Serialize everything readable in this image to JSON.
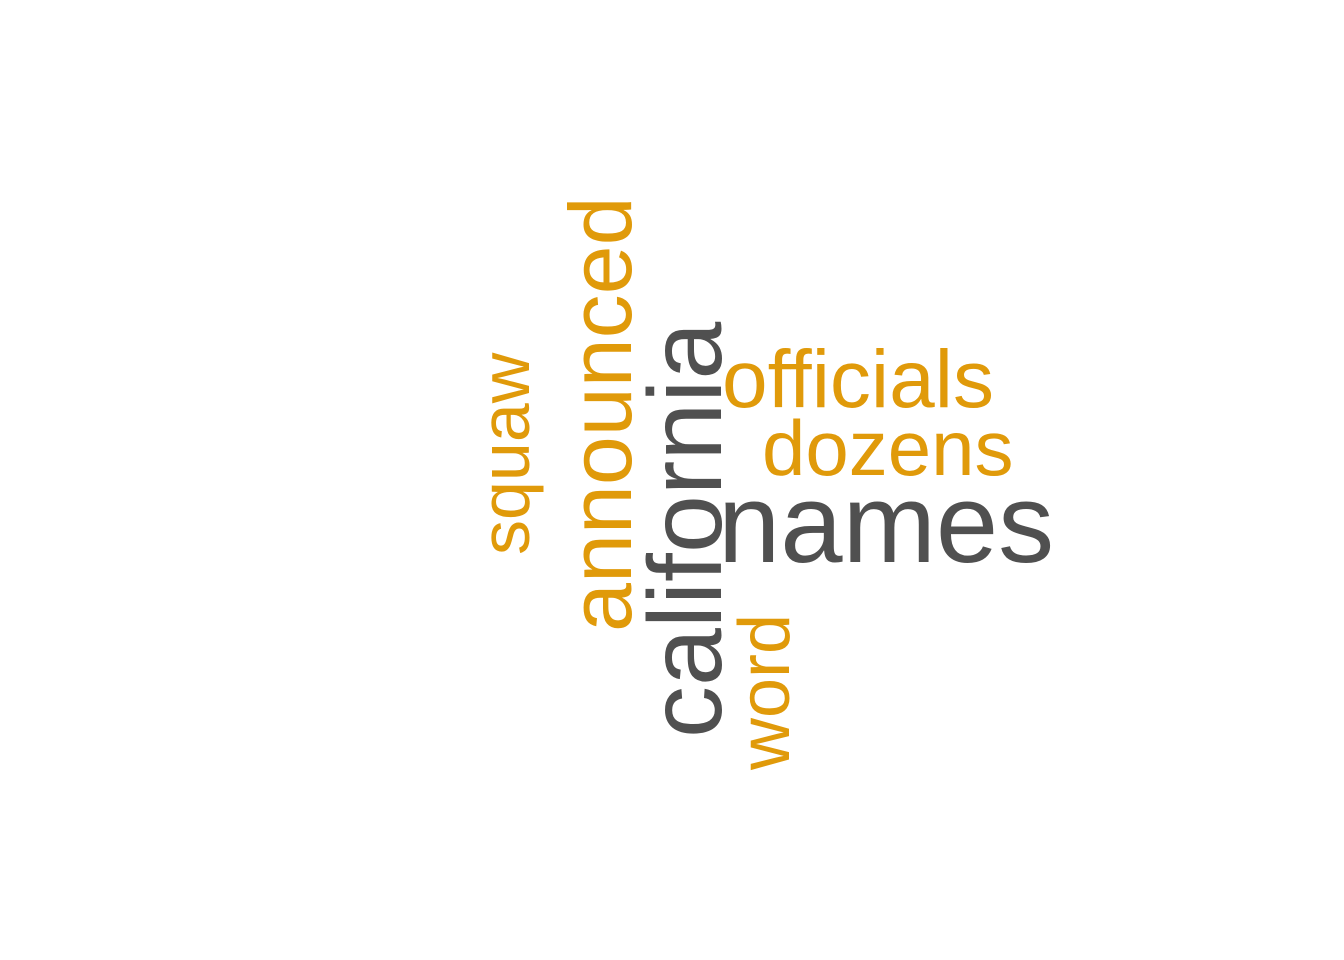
{
  "colors": {
    "background": "#ffffff",
    "accent": "#E09A0A",
    "dark": "#505050"
  },
  "words": {
    "california": "california",
    "names": "names",
    "officials": "officials",
    "dozens": "dozens",
    "announced": "announced",
    "squaw": "squaw",
    "word": "word"
  }
}
